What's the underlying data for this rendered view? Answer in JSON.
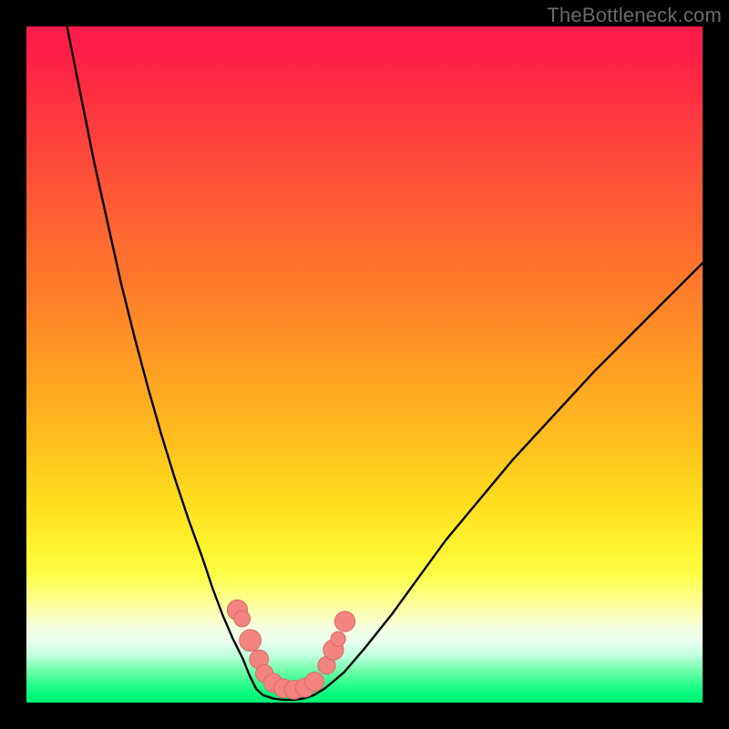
{
  "watermark": "TheBottleneck.com",
  "chart_data": {
    "type": "line",
    "title": "",
    "xlabel": "",
    "ylabel": "",
    "xlim": [
      0,
      100
    ],
    "ylim": [
      0,
      100
    ],
    "series": [
      {
        "name": "left-curve",
        "x": [
          6,
          8,
          10,
          12,
          14,
          16,
          18,
          20,
          22,
          24,
          26,
          27.5,
          29,
          30.5,
          32,
          33,
          34
        ],
        "y": [
          100,
          90,
          80,
          71,
          62,
          54,
          46.5,
          39.5,
          33,
          27,
          21.5,
          17,
          13,
          9.5,
          6.5,
          4,
          2
        ]
      },
      {
        "name": "valley-floor",
        "x": [
          34,
          35,
          36.5,
          38,
          39.5,
          41,
          42.5,
          44,
          45
        ],
        "y": [
          2,
          1.1,
          0.6,
          0.4,
          0.4,
          0.6,
          1.1,
          2,
          2.8
        ]
      },
      {
        "name": "right-curve",
        "x": [
          45,
          47,
          50,
          54,
          58,
          62,
          67,
          72,
          78,
          84,
          90,
          96,
          100
        ],
        "y": [
          2.8,
          4.5,
          8,
          13,
          18.5,
          24,
          30,
          36,
          42.5,
          49,
          55,
          61,
          65
        ]
      }
    ],
    "markers": [
      {
        "name": "left-marker-1",
        "x": 31.2,
        "y": 13.7,
        "r": 1.5
      },
      {
        "name": "left-marker-2",
        "x": 31.9,
        "y": 12.4,
        "r": 1.2
      },
      {
        "name": "left-marker-3",
        "x": 33.1,
        "y": 9.2,
        "r": 1.6
      },
      {
        "name": "left-marker-4",
        "x": 34.4,
        "y": 6.4,
        "r": 1.4
      },
      {
        "name": "floor-marker-1",
        "x": 35.2,
        "y": 4.3,
        "r": 1.3
      },
      {
        "name": "floor-marker-2",
        "x": 36.5,
        "y": 2.9,
        "r": 1.4
      },
      {
        "name": "floor-marker-3",
        "x": 38.0,
        "y": 2.1,
        "r": 1.4
      },
      {
        "name": "floor-marker-4",
        "x": 39.6,
        "y": 1.9,
        "r": 1.4
      },
      {
        "name": "floor-marker-5",
        "x": 41.2,
        "y": 2.2,
        "r": 1.4
      },
      {
        "name": "floor-marker-6",
        "x": 42.6,
        "y": 3.1,
        "r": 1.4
      },
      {
        "name": "right-marker-1",
        "x": 44.4,
        "y": 5.5,
        "r": 1.3
      },
      {
        "name": "right-marker-2",
        "x": 45.4,
        "y": 7.8,
        "r": 1.5
      },
      {
        "name": "right-marker-3",
        "x": 46.1,
        "y": 9.4,
        "r": 1.1
      },
      {
        "name": "right-marker-4",
        "x": 47.1,
        "y": 12.0,
        "r": 1.5
      }
    ],
    "colors": {
      "curve": "#000000",
      "marker_fill": "#f38480",
      "marker_stroke": "#db6a66"
    }
  }
}
